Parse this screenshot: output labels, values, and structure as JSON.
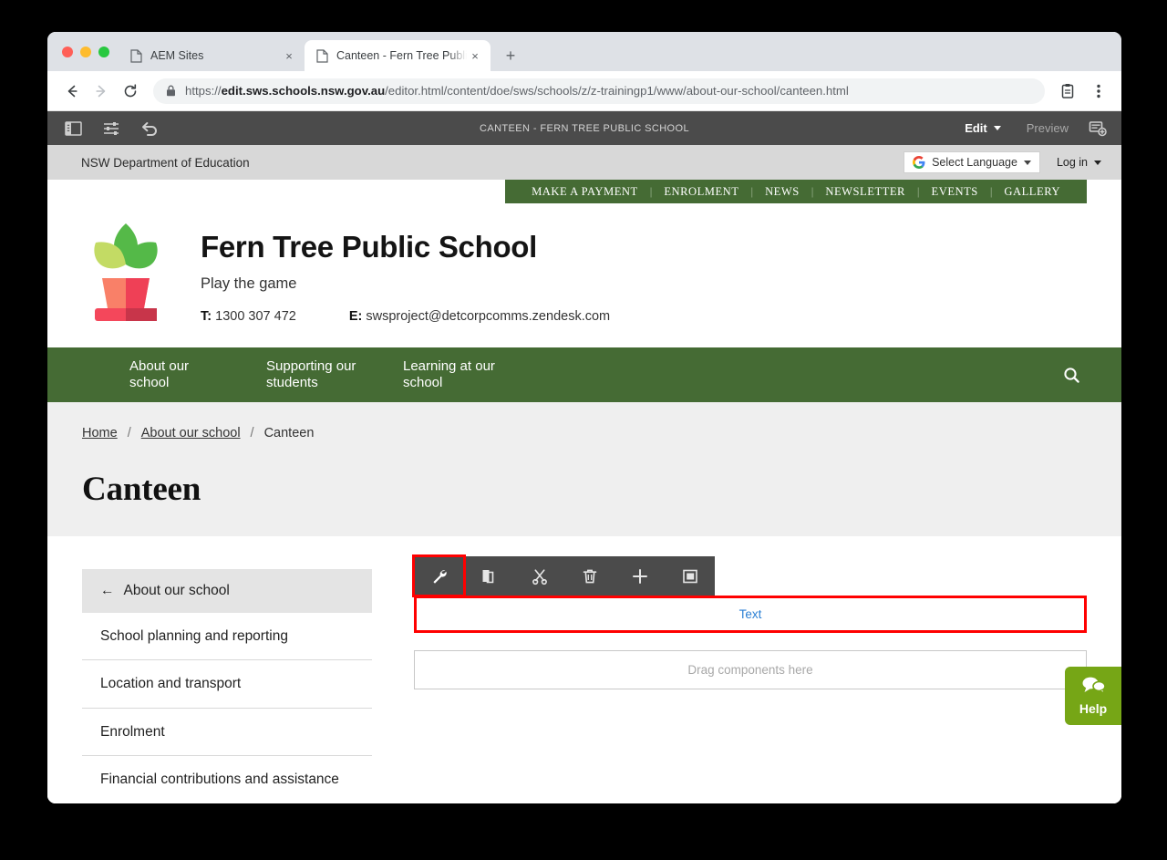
{
  "browser": {
    "tabs": [
      {
        "title": "AEM Sites",
        "active": false,
        "favicon": "page-icon"
      },
      {
        "title": "Canteen - Fern Tree Public Sch",
        "active": true,
        "favicon": "page-icon"
      }
    ],
    "new_tab_label": "+",
    "close_label": "×",
    "back_label": "←",
    "forward_label": "→",
    "reload_label": "↻",
    "url_prefix": "https://",
    "url_domain": "edit.sws.schools.nsw.gov.au",
    "url_path": "/editor.html/content/doe/sws/schools/z/z-trainingp1/www/about-our-school/canteen.html",
    "url_full": "https://edit.sws.schools.nsw.gov.au/editor.html/content/doe/sws/schools/z/z-trainingp1/www/about-our-school/canteen.html"
  },
  "aem_toolbar": {
    "title": "CANTEEN - FERN TREE PUBLIC SCHOOL",
    "sidebar_toggle": "side-panel-icon",
    "page_properties": "page-properties-icon",
    "undo": "undo-icon",
    "mode_edit": "Edit",
    "mode_preview": "Preview",
    "annotate": "annotate-icon"
  },
  "doe_bar": {
    "department": "NSW Department of Education",
    "language_label": "Select Language",
    "language_icon": "google-g-icon",
    "login_label": "Log in"
  },
  "utility_nav": {
    "items": [
      "MAKE A PAYMENT",
      "ENROLMENT",
      "NEWS",
      "NEWSLETTER",
      "EVENTS",
      "GALLERY"
    ],
    "separator": "|",
    "background": "#456b34"
  },
  "masthead": {
    "logo_icon": "plant-in-pot-logo",
    "school_name": "Fern Tree Public School",
    "tagline": "Play the game",
    "phone_label": "T:",
    "phone": "1300 307 472",
    "email_label": "E:",
    "email": "swsproject@detcorpcomms.zendesk.com"
  },
  "main_nav": {
    "items": [
      "About our school",
      "Supporting our students",
      "Learning at our school"
    ],
    "search_icon": "search-icon",
    "background": "#456b34"
  },
  "breadcrumb": {
    "items": [
      "Home",
      "About our school",
      "Canteen"
    ],
    "separator": "/"
  },
  "page_title": "Canteen",
  "side_menu": {
    "header": "About our school",
    "back_icon": "←",
    "items": [
      "School planning and reporting",
      "Location and transport",
      "Enrolment",
      "Financial contributions and assistance"
    ]
  },
  "component_toolbar": {
    "buttons": [
      {
        "name": "configure-button",
        "icon": "wrench-icon",
        "selected": true
      },
      {
        "name": "copy-button",
        "icon": "copy-icon",
        "selected": false
      },
      {
        "name": "cut-button",
        "icon": "scissors-icon",
        "selected": false
      },
      {
        "name": "delete-button",
        "icon": "trash-icon",
        "selected": false
      },
      {
        "name": "insert-button",
        "icon": "plus-icon",
        "selected": false
      },
      {
        "name": "group-button",
        "icon": "group-icon",
        "selected": false
      }
    ],
    "highlight_color": "#ff0000"
  },
  "editor_content": {
    "text_component_label": "Text",
    "dropzone_label": "Drag components here"
  },
  "help_widget": {
    "label": "Help",
    "icon": "chat-bubbles-icon",
    "color": "#76a616"
  }
}
